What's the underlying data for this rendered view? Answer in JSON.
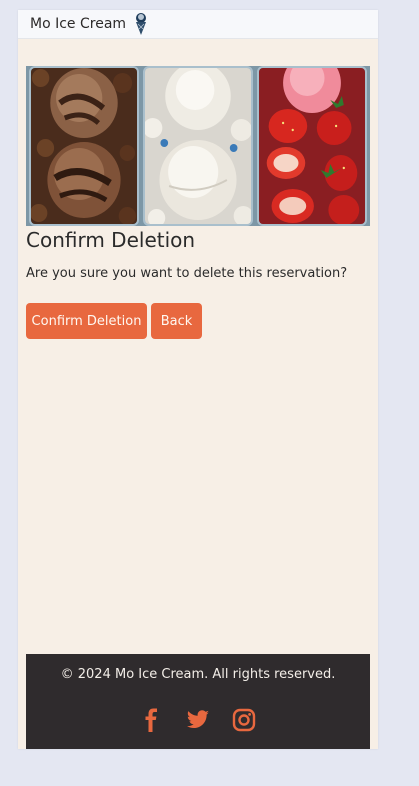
{
  "navbar": {
    "brand": "Mo Ice Cream",
    "brand_icon": "ice-cream-cone-icon"
  },
  "banner": {
    "flavors": [
      "chocolate",
      "vanilla",
      "strawberry"
    ]
  },
  "content": {
    "title": "Confirm Deletion",
    "question": "Are you sure you want to delete this reservation?",
    "confirm_label": "Confirm Deletion",
    "back_label": "Back"
  },
  "footer": {
    "copyright": "© 2024 Mo Ice Cream. All rights reserved.",
    "social": [
      "facebook-icon",
      "twitter-icon",
      "instagram-icon"
    ]
  },
  "colors": {
    "accent": "#e8683f",
    "background": "#f7efe6",
    "footer": "#2f2b2d",
    "page": "#e4e7f2"
  }
}
